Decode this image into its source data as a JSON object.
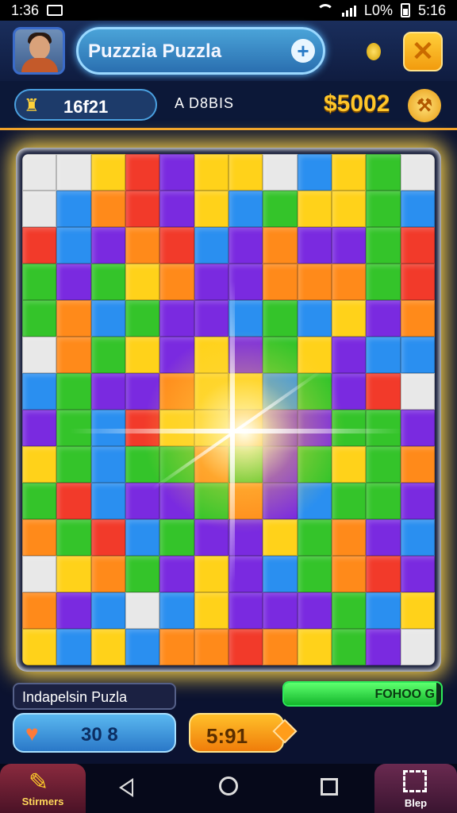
{
  "status_bar": {
    "time": "1:36",
    "battery_text": "L0%",
    "clock_right": "5:16"
  },
  "header": {
    "title": "Puzzzia Puzzla",
    "plus_label": "+",
    "close_label": "✕"
  },
  "info": {
    "level": "16f21",
    "mode": "A D8BIS",
    "score": "$5002"
  },
  "colors": {
    "red": "#f23a2a",
    "orange": "#ff8a1a",
    "yellow": "#ffd21a",
    "green": "#34c42a",
    "blue": "#2a8ff0",
    "purple": "#7a2ae0",
    "white": "#e8e8e8",
    "accent": "#f1a22a"
  },
  "board": {
    "rows": [
      [
        "white",
        "white",
        "yellow",
        "red",
        "purple",
        "yellow",
        "yellow",
        "white",
        "blue",
        "yellow",
        "green",
        "white"
      ],
      [
        "white",
        "blue",
        "orange",
        "red",
        "purple",
        "yellow",
        "blue",
        "green",
        "yellow",
        "yellow",
        "green",
        "blue"
      ],
      [
        "red",
        "blue",
        "purple",
        "orange",
        "red",
        "blue",
        "purple",
        "orange",
        "purple",
        "purple",
        "green",
        "red"
      ],
      [
        "green",
        "purple",
        "green",
        "yellow",
        "orange",
        "purple",
        "purple",
        "orange",
        "orange",
        "orange",
        "green",
        "red"
      ],
      [
        "green",
        "orange",
        "blue",
        "green",
        "purple",
        "purple",
        "blue",
        "green",
        "blue",
        "yellow",
        "purple",
        "orange"
      ],
      [
        "white",
        "orange",
        "green",
        "yellow",
        "purple",
        "yellow",
        "purple",
        "green",
        "yellow",
        "purple",
        "blue",
        "blue"
      ],
      [
        "blue",
        "green",
        "purple",
        "purple",
        "orange",
        "yellow",
        "yellow",
        "blue",
        "green",
        "purple",
        "red",
        "white"
      ],
      [
        "purple",
        "green",
        "blue",
        "red",
        "yellow",
        "yellow",
        "orange",
        "purple",
        "purple",
        "green",
        "green",
        "purple"
      ],
      [
        "yellow",
        "green",
        "blue",
        "green",
        "green",
        "orange",
        "green",
        "purple",
        "green",
        "yellow",
        "green",
        "orange"
      ],
      [
        "green",
        "red",
        "blue",
        "purple",
        "purple",
        "green",
        "orange",
        "purple",
        "blue",
        "green",
        "green",
        "purple"
      ],
      [
        "orange",
        "green",
        "red",
        "blue",
        "green",
        "purple",
        "purple",
        "yellow",
        "green",
        "orange",
        "purple",
        "blue"
      ],
      [
        "white",
        "yellow",
        "orange",
        "green",
        "purple",
        "yellow",
        "purple",
        "blue",
        "green",
        "orange",
        "red",
        "purple"
      ],
      [
        "orange",
        "purple",
        "blue",
        "white",
        "blue",
        "yellow",
        "purple",
        "purple",
        "purple",
        "green",
        "blue",
        "yellow"
      ],
      [
        "yellow",
        "blue",
        "yellow",
        "blue",
        "orange",
        "orange",
        "red",
        "orange",
        "yellow",
        "green",
        "purple",
        "white"
      ]
    ]
  },
  "bottom": {
    "puzzle_name": "Indapelsin Puzla",
    "progress_label": "FOHOO G",
    "progress_fraction": 0.97,
    "lives": "30 8",
    "timer": "5:91"
  },
  "nav": {
    "left_label": "Stirmers",
    "right_label": "Blep"
  }
}
